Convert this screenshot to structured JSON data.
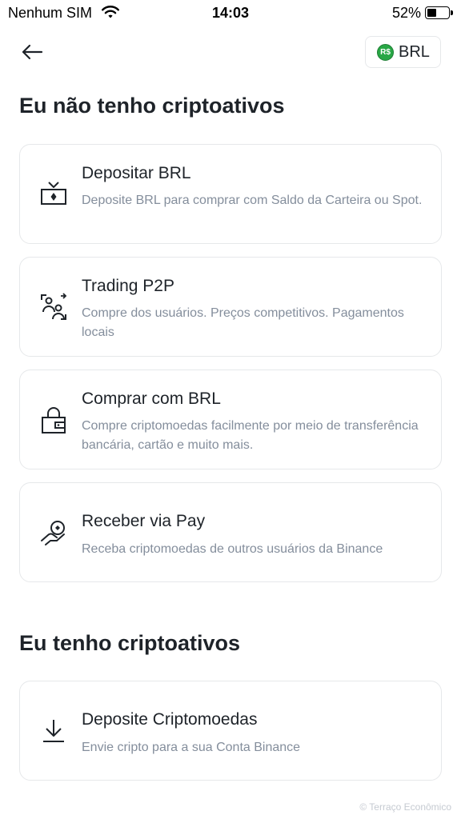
{
  "status_bar": {
    "carrier": "Nenhum SIM",
    "time": "14:03",
    "battery": "52%",
    "battery_level": 0.52
  },
  "header": {
    "back_icon": "arrow-left-icon",
    "currency_label": "BRL",
    "currency_coin": "R$"
  },
  "sections": {
    "no_crypto_title": "Eu não tenho criptoativos",
    "have_crypto_title": "Eu tenho criptoativos"
  },
  "options": [
    {
      "icon": "deposit-icon",
      "title": "Depositar BRL",
      "desc": "Deposite BRL para comprar com Saldo da Carteira ou Spot."
    },
    {
      "icon": "p2p-users-icon",
      "title": "Trading P2P",
      "desc": "Compre dos usuários. Preços competitivos. Pagamentos locais"
    },
    {
      "icon": "wallet-lock-icon",
      "title": "Comprar com BRL",
      "desc": "Compre criptomoedas facilmente por meio de transferência bancária, cartão e muito mais."
    },
    {
      "icon": "pay-hand-icon",
      "title": "Receber via Pay",
      "desc": "Receba criptomoedas de outros usuários da Binance"
    },
    {
      "icon": "download-icon",
      "title": "Deposite Criptomoedas",
      "desc": "Envie cripto para a sua Conta Binance"
    }
  ],
  "colors": {
    "text_primary": "#1e2329",
    "text_secondary": "#848e9c",
    "card_border": "#e6e8ea",
    "coin_green": "#28a745"
  },
  "watermark": "© Terraço Econômico"
}
